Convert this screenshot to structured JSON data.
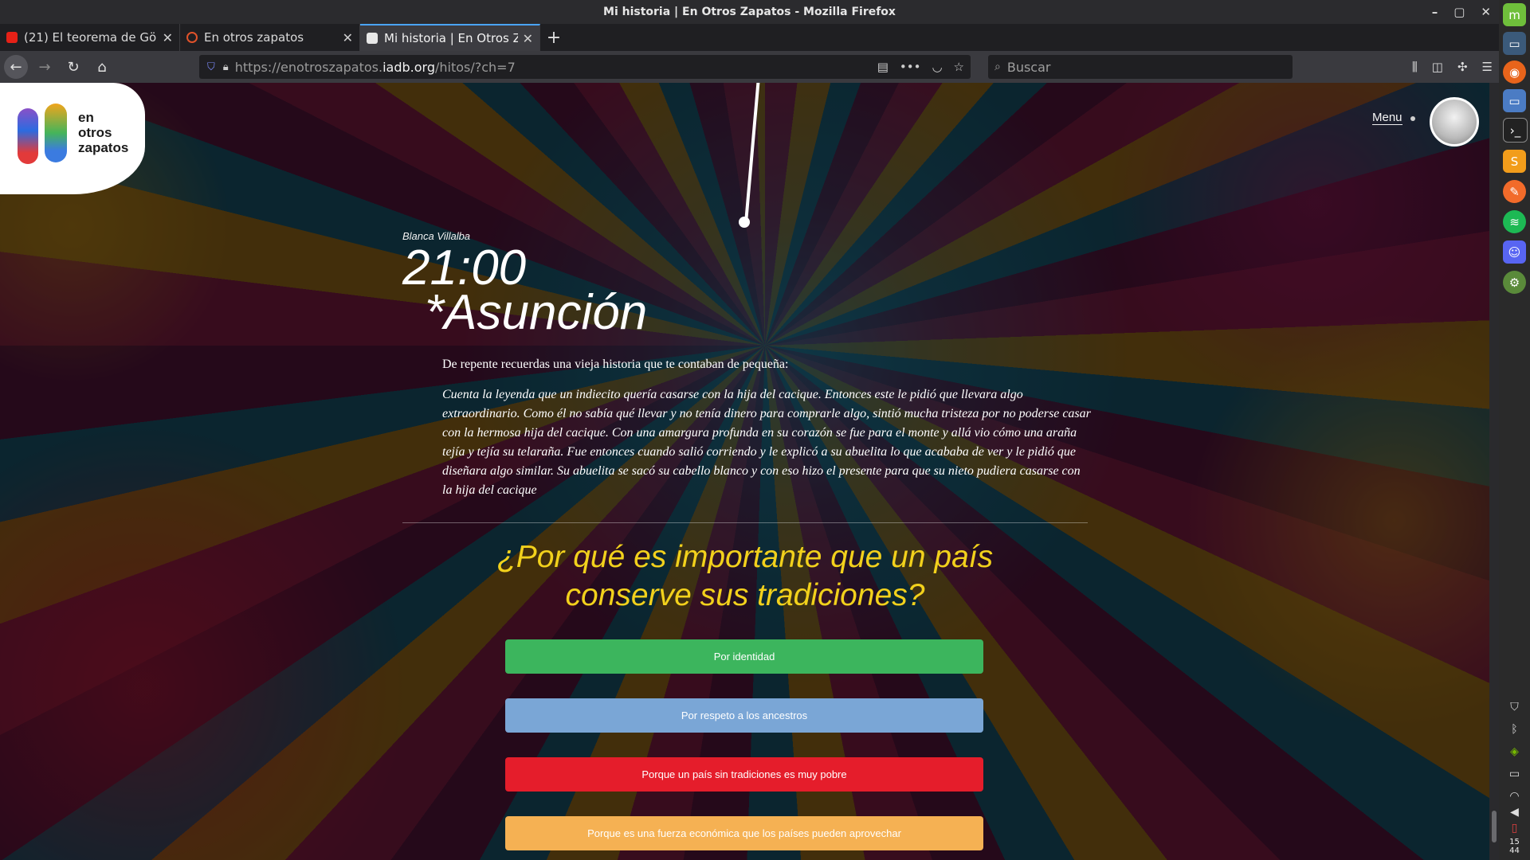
{
  "window": {
    "title": "Mi historia | En Otros Zapatos - Mozilla Firefox",
    "controls": [
      "–",
      "▢",
      "✕"
    ]
  },
  "tabs": [
    {
      "label": "(21) El teorema de Gö",
      "favicon_color": "#e62117"
    },
    {
      "label": "En otros zapatos",
      "favicon_color": "#e0522a"
    },
    {
      "label": "Mi historia | En Otros Z",
      "favicon_color": "#e8e8e8",
      "active": true
    }
  ],
  "nav": {
    "url_prefix": "https://enotroszapatos.",
    "url_host": "iadb.org",
    "url_path": "/hitos/?ch=7",
    "search_placeholder": "Buscar"
  },
  "page": {
    "logo_text": [
      "en",
      "otros",
      "zapatos"
    ],
    "menu_label": "Menu",
    "author": "Blanca Villalba",
    "time": "21:00",
    "city": "*Asunción",
    "intro": "De repente recuerdas una vieja historia que te contaban de pequeña:",
    "story": "Cuenta la leyenda que un indiecito quería casarse con la hija del cacique. Entonces este le pidió que llevara algo extraordinario. Como él no sabía qué llevar y no tenía dinero para comprarle algo, sintió mucha tristeza por no poderse casar con la hermosa hija del cacique. Con una amargura profunda en su corazón se fue para el monte y allá vio cómo una araña tejía y tejía su telaraña. Fue entonces cuando salió corriendo y le explicó a su abuelita lo que acababa de ver y le pidió que diseñara algo similar. Su abuelita se sacó su cabello blanco y con eso hizo el presente para que su nieto pudiera casarse con la hija del cacique",
    "question": "¿Por qué es importante que un país conserve sus tradiciones?",
    "options": [
      {
        "label": "Por identidad",
        "color": "#3cb55d"
      },
      {
        "label": "Por respeto a los ancestros",
        "color": "#7aa6d6"
      },
      {
        "label": "Porque un país sin tradiciones es muy pobre",
        "color": "#e51d2b"
      },
      {
        "label": "Porque es una fuerza económica que los países pueden aprovechar",
        "color": "#f5b153"
      }
    ]
  },
  "system": {
    "clock": [
      "15",
      "44"
    ]
  }
}
